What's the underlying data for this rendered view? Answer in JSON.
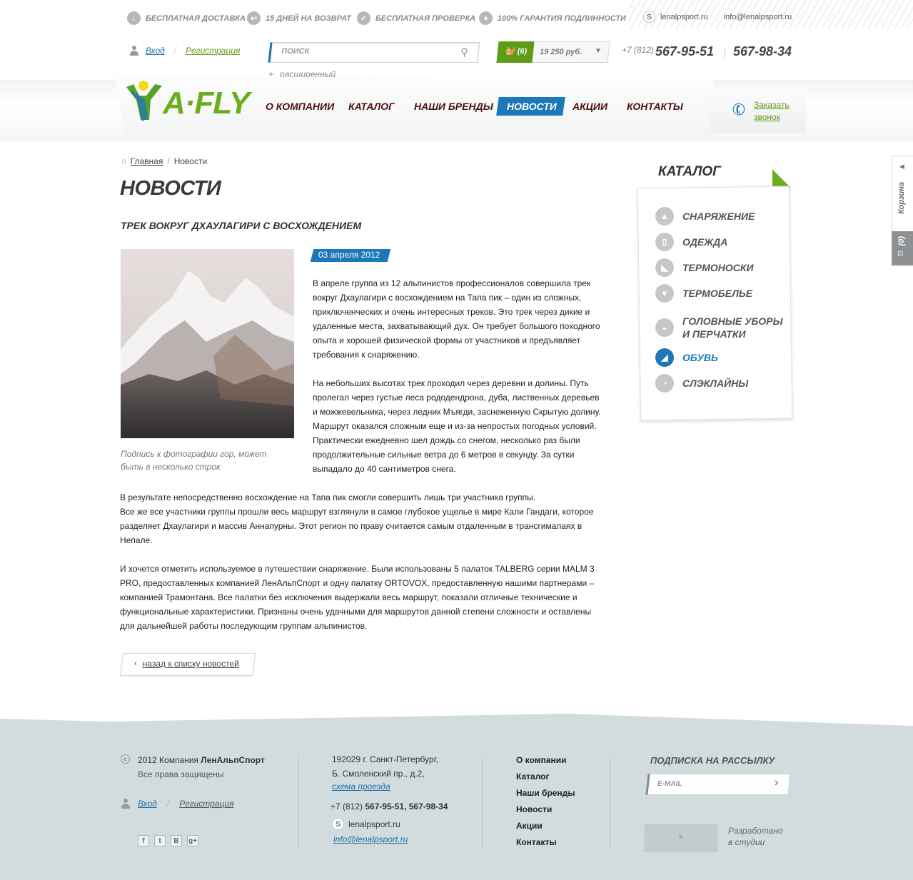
{
  "top_benefits": [
    {
      "icon": "download-arrow-icon",
      "label": "Бесплатная доставка"
    },
    {
      "icon": "return-arrow-icon",
      "label": "15 дней на возврат"
    },
    {
      "icon": "checkmark-icon",
      "label": "Бесплатная проверка"
    },
    {
      "icon": "thumbs-up-icon",
      "label": "100% гарантия подлинности"
    }
  ],
  "top_contacts": {
    "skype": "lenalpsport.ru",
    "email": "info@lenalpsport.ru"
  },
  "auth": {
    "login": "Вход",
    "register": "Регистрация"
  },
  "search": {
    "placeholder": "поиск",
    "advanced": "расширенный"
  },
  "cart": {
    "count": "(6)",
    "total": "19 250 руб."
  },
  "phone": {
    "code": "+7 (812)",
    "number1": "567-95-51",
    "number2": "567-98-34"
  },
  "logo": {
    "text": "A·FLY"
  },
  "nav": [
    {
      "label": "О компании"
    },
    {
      "label": "Каталог"
    },
    {
      "label": "Наши бренды"
    },
    {
      "label": "Новости",
      "active": true
    },
    {
      "label": "Акции"
    },
    {
      "label": "Контакты"
    }
  ],
  "callback": {
    "line1": "Заказать",
    "line2": "звонок"
  },
  "breadcrumb": {
    "home": "Главная",
    "separator": "/",
    "current": "Новости"
  },
  "page_title": "Новости",
  "article": {
    "title": "Трек вокруг Дхаулагири с восхождением",
    "date": "03 апреля 2012",
    "caption_line1": "Подпись к фотографии гор, может",
    "caption_line2": "быть в несколько строк",
    "para1": [
      "В апреле группа из 12 альпинистов профессионалов совершила трек",
      "вокруг Дхаулагири  с восхождением на Тапа пик – один из сложных,",
      "приключенческих и очень интересных треков. Это трек через дикие и",
      "удаленные места, захватывающий дух. Он требует большого походного",
      "опыта и хорошей физической формы от участников и предъявляет",
      "требования к снаряжению."
    ],
    "para2": [
      "На небольших высотах трек проходил через деревни и долины. Путь",
      "пролегал через густые леса рододендрона, дуба, лиственных деревьев",
      "и можжевельника, через ледник Мъягди, заснеженную Скрытую долину.",
      "Маршрут оказался сложным еще и из-за непростых погодных условий.",
      "Практически ежедневно шел дождь со снегом, несколько раз были",
      "продолжительные сильные ветра до 6 метров в секунду. За сутки",
      "выпадало до 40 сантиметров снега."
    ],
    "para3": [
      "В результате непосредственно восхождение на Тапа пик смогли совершить лишь три участника группы.",
      "Все же все участники группы прошли весь маршрут взглянули в самое глубокое ущелье в мире Кали Гандаги, которое",
      "разделяет Дхаулагири  и массив Аннапурны. Этот регион по праву считается самым отдаленным в трансгималаях в",
      "Непале."
    ],
    "para4": [
      "И хочется отметить используемое в путешествии снаряжение. Были использованы 5 палаток TALBERG серии MALM 3",
      "PRO, предоставленных компанией ЛенАльпСпорт и одну палатку ORTOVOX, предоставленную нашими партнерами –",
      "компанией Трамонтана. Все палатки без исключения выдержали весь маршрут, показали отличные технические и",
      "функциональные характеристики. Признаны очень удачными для маршрутов данной степени сложности и оставлены",
      "для дальнейшей работы последующим группам альпинистов."
    ],
    "back": "назад к списку новостей"
  },
  "catalog": {
    "title": "Каталог",
    "items": [
      {
        "label": "Снаряжение",
        "icon": "tent-icon"
      },
      {
        "label": "Одежда",
        "icon": "jacket-icon"
      },
      {
        "label": "Термоноски",
        "icon": "sock-icon"
      },
      {
        "label": "Термобелье",
        "icon": "shirt-icon"
      },
      {
        "label": "Головные уборы",
        "label2": "и перчатки",
        "icon": "hat-icon"
      },
      {
        "label": "Обувь",
        "icon": "shoe-icon",
        "active": true
      },
      {
        "label": "Слэклайны",
        "icon": "slackline-icon"
      }
    ]
  },
  "side_cart": {
    "label": "Корзина",
    "count": "(0)"
  },
  "footer": {
    "copyright": "2012 Компания",
    "company": "ЛенАльпСпорт",
    "rights": "Все права защищены",
    "login": "Вход",
    "register": "Регистрация",
    "address1": "192029 г. Санкт-Петербург,",
    "address2": "Б. Смоленский пр., д.2,",
    "map_link": "схема проезда",
    "phone_code": "+7 (812)",
    "phones": "567-95-51, 567-98-34",
    "skype": "lenalpsport.ru",
    "email": "info@lenalpsport.ru",
    "nav": [
      "О компании",
      "Каталог",
      "Наши бренды",
      "Новости",
      "Акции",
      "Контакты"
    ],
    "subscribe_title": "Подписка на рассылку",
    "email_placeholder": "E-MAIL",
    "studio_line1": "Разработано",
    "studio_line2": "в студии",
    "studio_logo": "x",
    "social": [
      {
        "icon": "facebook-icon",
        "glyph": "f"
      },
      {
        "icon": "twitter-icon",
        "glyph": "t"
      },
      {
        "icon": "vkontakte-icon",
        "glyph": "B"
      },
      {
        "icon": "google-plus-icon",
        "glyph": "g+"
      }
    ]
  },
  "colors": {
    "accent_blue": "#1c78b6",
    "accent_green": "#6aae1f",
    "nav_text": "#4a1010",
    "footer_bg": "#d2dcdf"
  }
}
